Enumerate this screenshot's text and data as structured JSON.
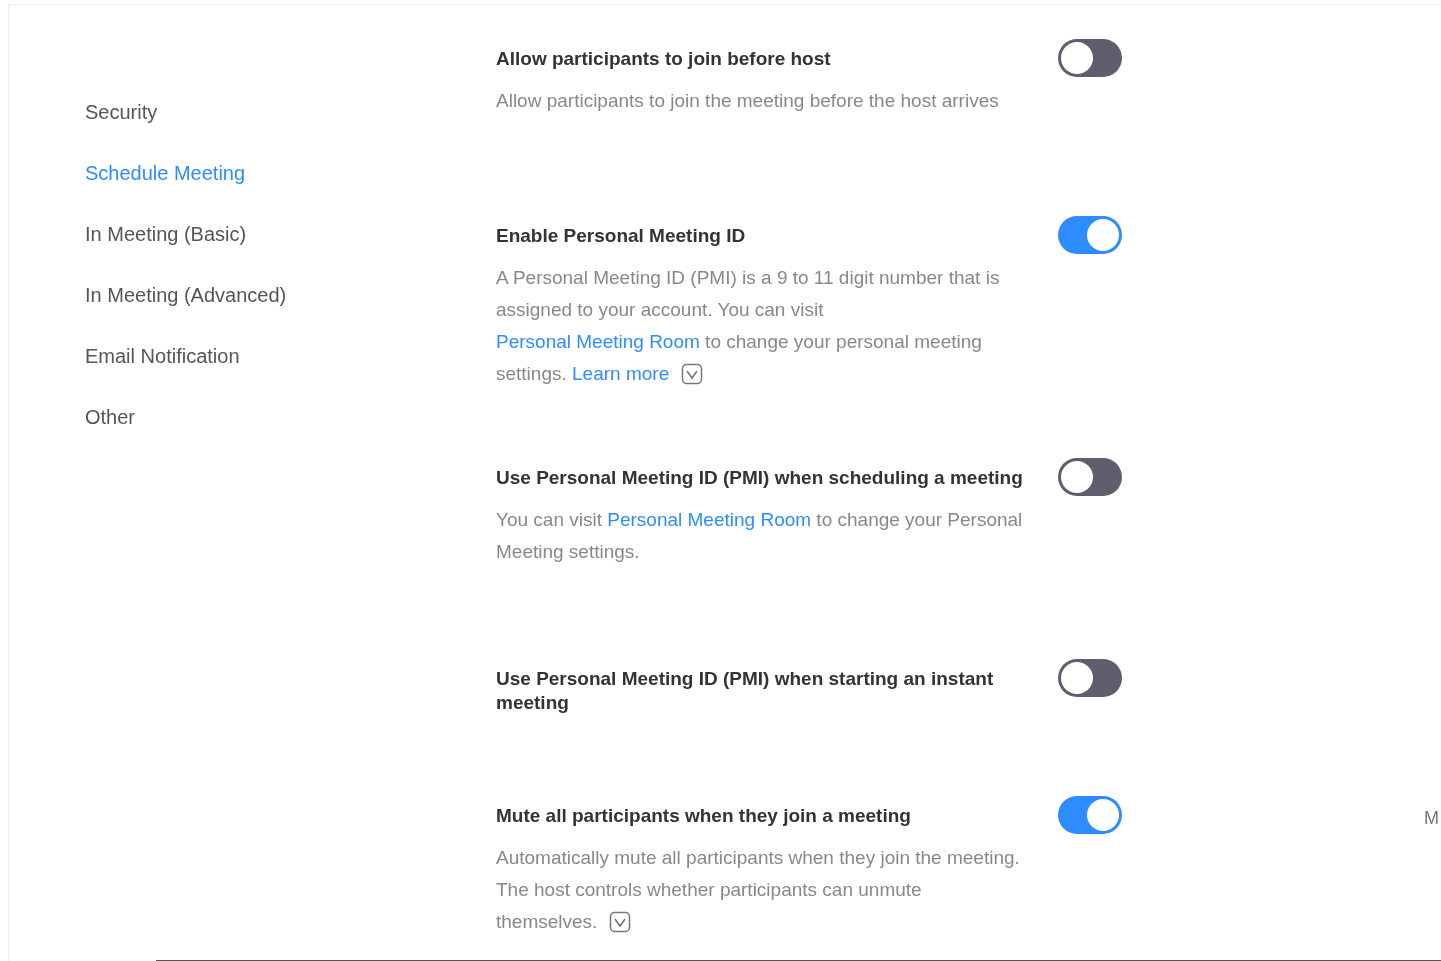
{
  "sidebar": {
    "items": [
      {
        "label": "Security",
        "selected": false
      },
      {
        "label": "Schedule Meeting",
        "selected": true
      },
      {
        "label": "In Meeting (Basic)",
        "selected": false
      },
      {
        "label": "In Meeting (Advanced)",
        "selected": false
      },
      {
        "label": "Email Notification",
        "selected": false
      },
      {
        "label": "Other",
        "selected": false
      }
    ]
  },
  "settings": [
    {
      "title": "Allow participants to join before host",
      "on": false,
      "help_icon": false,
      "description": [
        {
          "kind": "text",
          "text": "Allow participants to join the meeting before the host arrives"
        }
      ]
    },
    {
      "title": "Enable Personal Meeting ID",
      "on": true,
      "help_icon": true,
      "description": [
        {
          "kind": "text",
          "text": "A Personal Meeting ID (PMI) is a 9 to 11 digit number that is assigned to your account. You can visit "
        },
        {
          "kind": "link",
          "text": "Personal Meeting Room"
        },
        {
          "kind": "text",
          "text": " to change your personal meeting settings. "
        },
        {
          "kind": "link",
          "text": "Learn more"
        }
      ]
    },
    {
      "title": "Use Personal Meeting ID (PMI) when scheduling a meeting",
      "on": false,
      "help_icon": false,
      "description": [
        {
          "kind": "text",
          "text": "You can visit "
        },
        {
          "kind": "link",
          "text": "Personal Meeting Room"
        },
        {
          "kind": "text",
          "text": " to change your Personal Meeting settings."
        }
      ]
    },
    {
      "title": "Use Personal Meeting ID (PMI) when starting an instant meeting",
      "on": false,
      "help_icon": false
    },
    {
      "title": "Mute all participants when they join a meeting",
      "on": true,
      "help_icon": true,
      "description": [
        {
          "kind": "text",
          "text": "Automatically mute all participants when they join the meeting. The host controls whether participants can unmute themselves."
        }
      ]
    }
  ],
  "edge_text": "M"
}
